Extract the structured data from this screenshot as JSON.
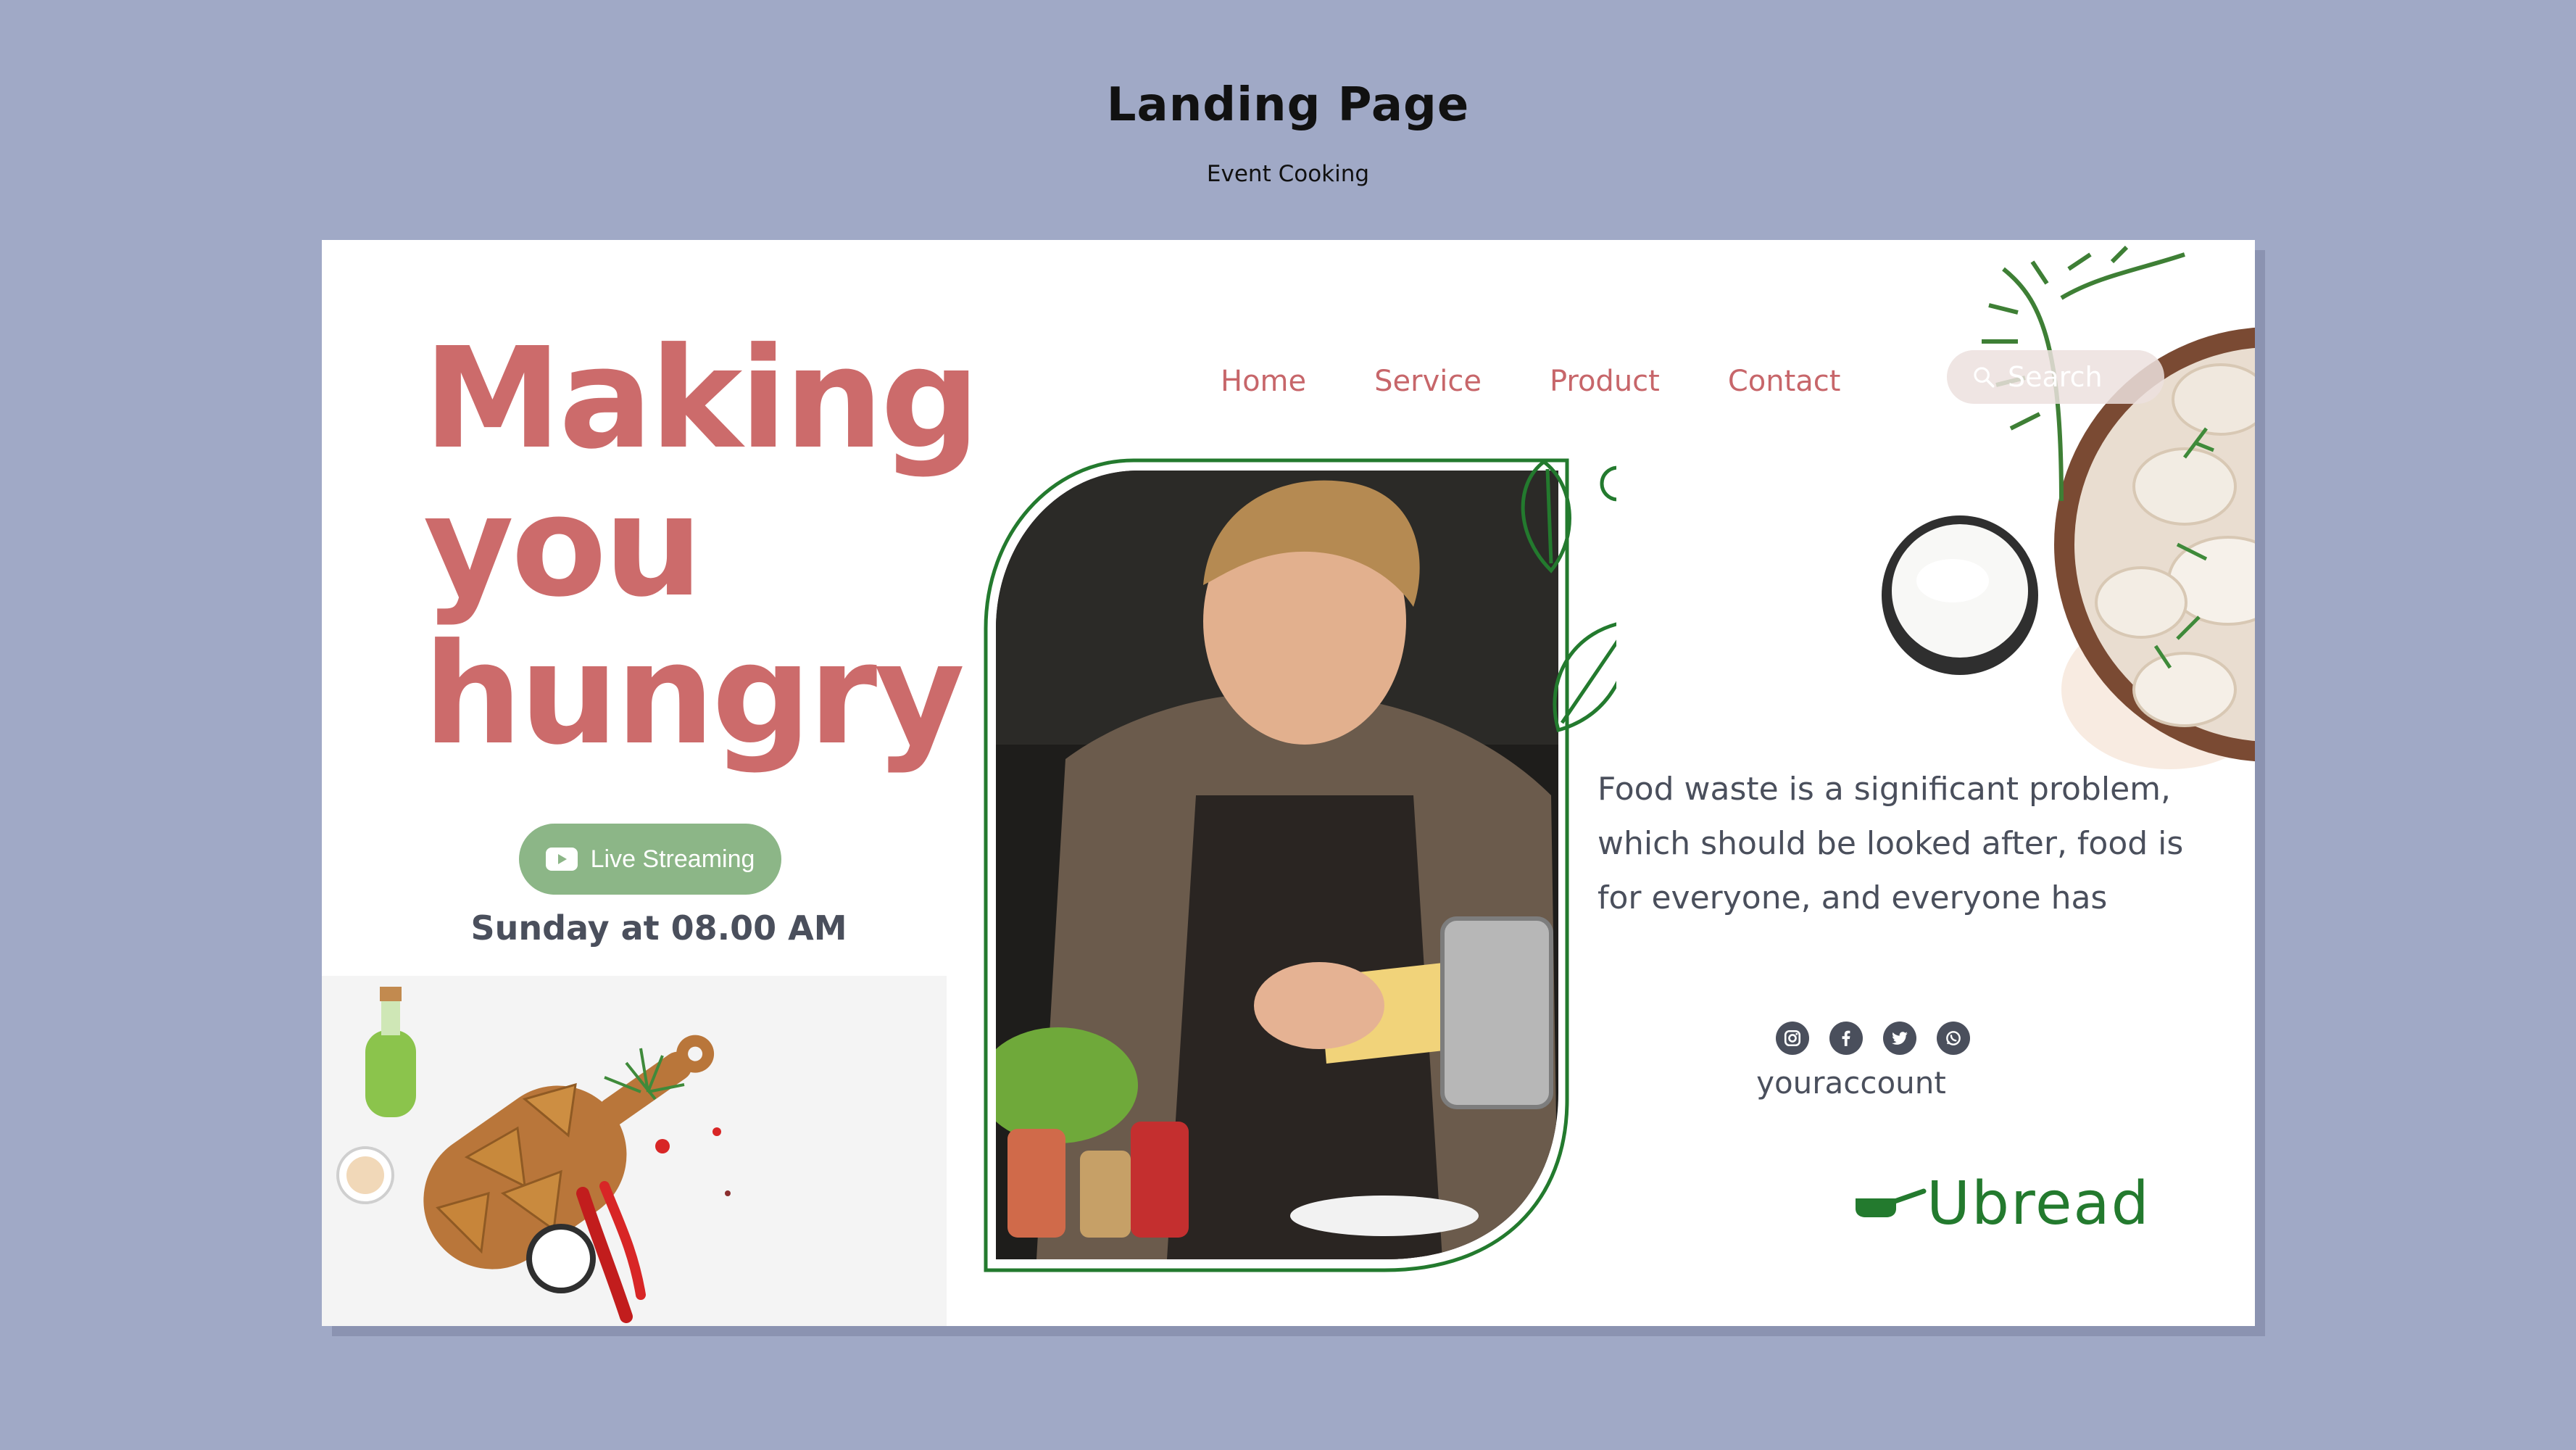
{
  "header": {
    "title": "Landing Page",
    "subtitle": "Event Cooking"
  },
  "nav": {
    "items": [
      {
        "label": "Home"
      },
      {
        "label": "Service"
      },
      {
        "label": "Product"
      },
      {
        "label": "Contact"
      }
    ],
    "search_placeholder": "Search"
  },
  "hero": {
    "line1": "Making",
    "line2": "you",
    "line3": "hungry"
  },
  "live": {
    "button_label": "Live Streaming",
    "schedule": "Sunday at 08.00 AM"
  },
  "description": "Food waste is a significant problem, which should be looked after, food is for everyone, and everyone has",
  "social": {
    "icons": [
      "instagram-icon",
      "facebook-icon",
      "twitter-icon",
      "whatsapp-icon"
    ],
    "account": "youraccount"
  },
  "brand": {
    "name": "Ubread"
  },
  "colors": {
    "background": "#a0a9c6",
    "accent_red": "#cc6b6b",
    "accent_green": "#237a2e",
    "button_green": "#8cb687",
    "text_dark": "#4a4f5c"
  }
}
